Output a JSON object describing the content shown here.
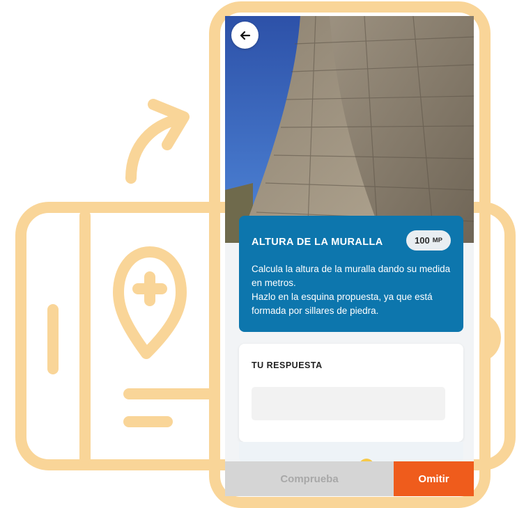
{
  "colors": {
    "illustration": "#f9d598",
    "card_blue": "#0d76ad",
    "skip_orange": "#ef5c1c",
    "check_gray": "#d5d5d5"
  },
  "header": {
    "back_icon": "arrow-left-icon"
  },
  "challenge": {
    "title": "ALTURA DE LA MURALLA",
    "points_value": "100",
    "points_unit": "MP",
    "description": "Calcula la altura de la muralla dando su medida en metros.\nHazlo en la esquina propuesta, ya que está formada por sillares de piedra."
  },
  "answer": {
    "label": "TU RESPUESTA",
    "value": "",
    "placeholder": ""
  },
  "actions": {
    "check_label": "Comprueba",
    "skip_label": "Omitir"
  }
}
